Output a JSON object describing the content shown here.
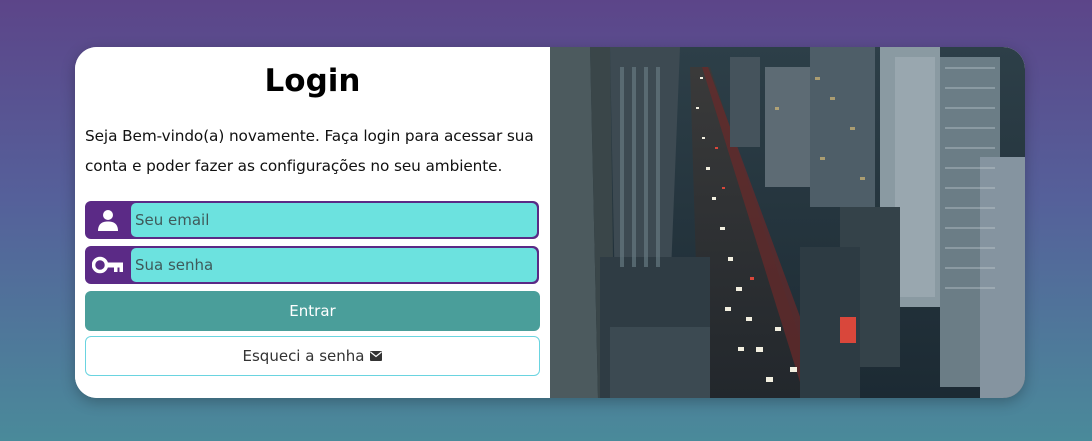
{
  "login": {
    "title": "Login",
    "description": "Seja Bem-vindo(a) novamente. Faça login para acessar sua conta e poder fazer as configurações no seu ambiente.",
    "email_placeholder": "Seu email",
    "email_icon": "user-icon",
    "password_placeholder": "Sua senha",
    "password_icon": "key-icon",
    "submit_label": "Entrar",
    "forgot_label": "Esqueci a senha",
    "forgot_icon": "envelope-icon"
  },
  "colors": {
    "icon_bg": "#5b2a86",
    "input_bg": "#6ce2df",
    "submit_bg": "#4a9e9a",
    "outline_border": "#6ad4e0"
  },
  "image": {
    "subject": "city-street-icon"
  }
}
